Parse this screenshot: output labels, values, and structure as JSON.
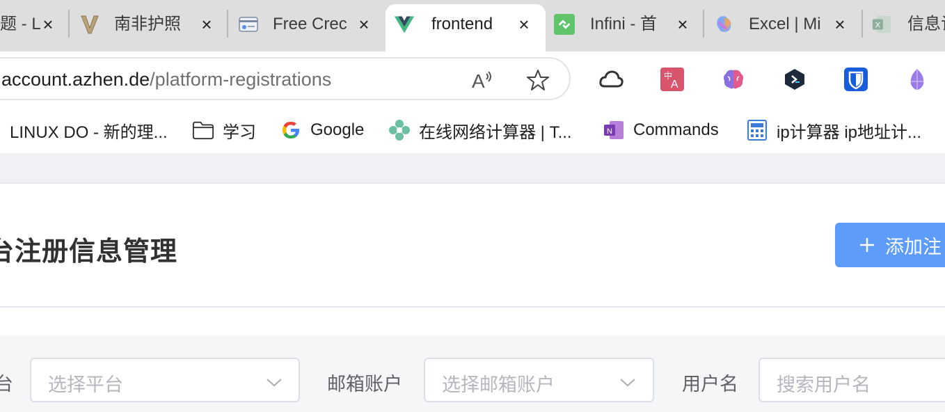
{
  "browser": {
    "tabs": [
      {
        "title": "题 - L",
        "icon": "linux-do-icon"
      },
      {
        "title": "南非护照 -",
        "icon": "v-logo-icon"
      },
      {
        "title": "Free Crec",
        "icon": "credit-card-icon"
      },
      {
        "title": "frontend",
        "icon": "vue-icon"
      },
      {
        "title": "Infini - 首",
        "icon": "infini-icon"
      },
      {
        "title": "Excel | Mi",
        "icon": "copilot-icon"
      },
      {
        "title": "信息记",
        "icon": "excel-icon"
      }
    ],
    "active_tab": "frontend",
    "address_bar": {
      "host": "account.azhen.de",
      "path": "/platform-registrations"
    },
    "toolbar_icons": [
      "read-aloud-icon",
      "favorite-star-icon"
    ],
    "extensions": [
      "cloud-icon",
      "translate-icon",
      "brain-icon",
      "dev-extension-icon",
      "bitwarden-icon",
      "crystal-icon"
    ],
    "bookmarks": [
      {
        "label": "LINUX DO - 新的理...",
        "icon": "linux-do-icon"
      },
      {
        "label": "学习",
        "icon": "folder-icon"
      },
      {
        "label": "Google",
        "icon": "google-icon"
      },
      {
        "label": "在线网络计算器 | T...",
        "icon": "flower-icon"
      },
      {
        "label": "Commands",
        "icon": "onenote-icon"
      },
      {
        "label": "ip计算器 ip地址计...",
        "icon": "calculator-icon"
      }
    ]
  },
  "page": {
    "title": "台注册信息管理",
    "add_button": "添加注",
    "filters": [
      {
        "label": "台",
        "placeholder": "选择平台",
        "type": "select"
      },
      {
        "label": "邮箱账户",
        "placeholder": "选择邮箱账户",
        "type": "select"
      },
      {
        "label": "用户名",
        "placeholder": "搜索用户名",
        "type": "input"
      }
    ]
  },
  "colors": {
    "primary": "#5d9cf8",
    "tab_strip": "#dedede",
    "vue_green": "#41b883"
  }
}
